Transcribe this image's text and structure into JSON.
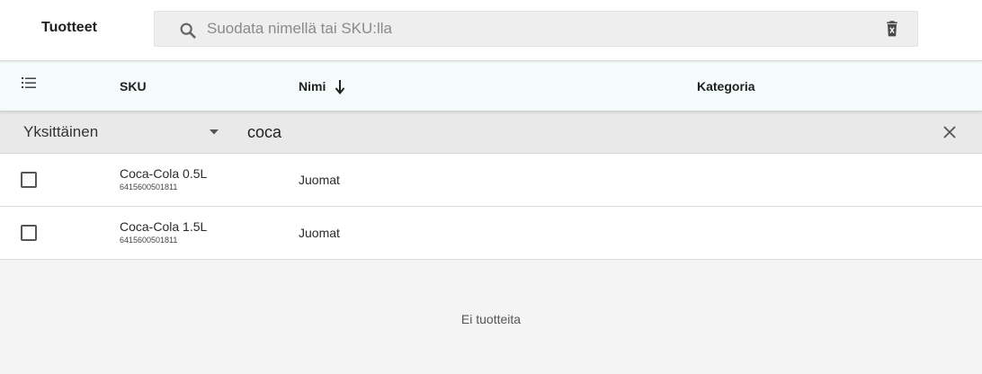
{
  "header": {
    "title": "Tuotteet",
    "search": {
      "placeholder": "Suodata nimellä tai SKU:lla",
      "value": "",
      "icon": "search-icon",
      "clear_icon": "delete-icon"
    }
  },
  "columns": {
    "options_icon": "list-options-icon",
    "sku": "SKU",
    "name": "Nimi",
    "name_sort": "descending",
    "category": "Kategoria"
  },
  "filter": {
    "type_value": "Yksittäinen",
    "text_value": "coca",
    "clear_icon": "close-icon"
  },
  "rows": [
    {
      "name": "Coca-Cola 0.5L",
      "barcode": "6415600501811",
      "category": "Juomat",
      "checked": false
    },
    {
      "name": "Coca-Cola 1.5L",
      "barcode": "6415600501811",
      "category": "Juomat",
      "checked": false
    }
  ],
  "empty_text": "Ei tuotteita",
  "colors": {
    "header_bg": "#f3fbfb",
    "filter_bg": "#e9e9e9",
    "search_bg": "#eeeeee",
    "page_bg": "#f4f4f4"
  }
}
